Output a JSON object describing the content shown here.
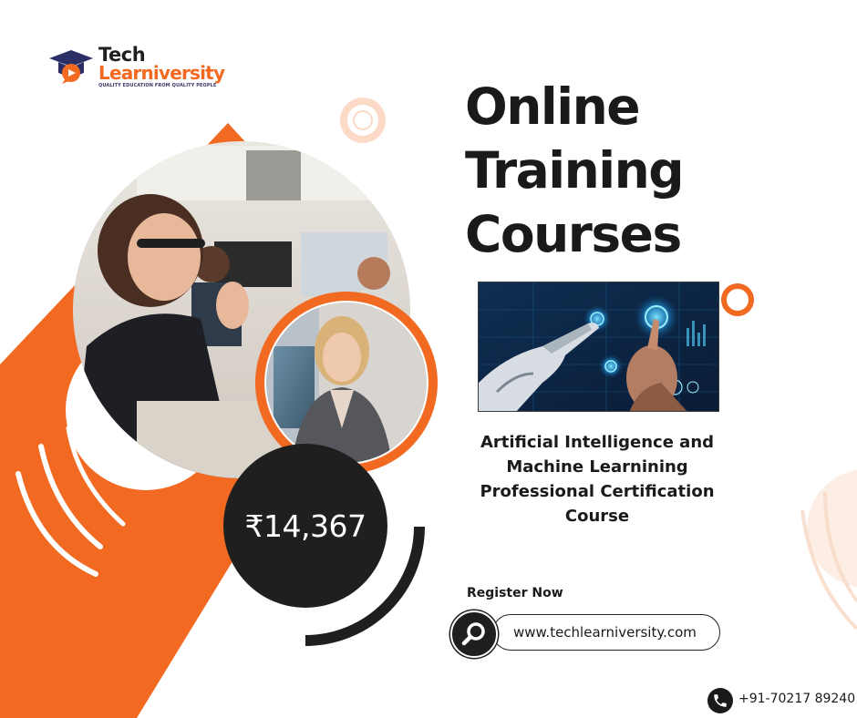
{
  "brand": {
    "name_line1": "Tech",
    "name_line2": "Learniversity",
    "tagline": "QUALITY EDUCATION FROM QUALITY PEOPLE"
  },
  "headline": {
    "line1": "Online",
    "line2": "Training",
    "line3": "Courses"
  },
  "price": "₹14,367",
  "course": {
    "title": "Artificial Intelligence and Machine Learnining Professional Certification Course"
  },
  "cta": {
    "register_label": "Register Now",
    "website": "www.techlearniversity.com"
  },
  "contact": {
    "phone": "+91-70217 89240"
  },
  "colors": {
    "accent": "#f26a21",
    "dark": "#1f1f1f",
    "background": "#ffffff"
  },
  "icons": {
    "logo": "graduation-cap-icon",
    "search": "search-icon",
    "phone": "phone-icon"
  }
}
